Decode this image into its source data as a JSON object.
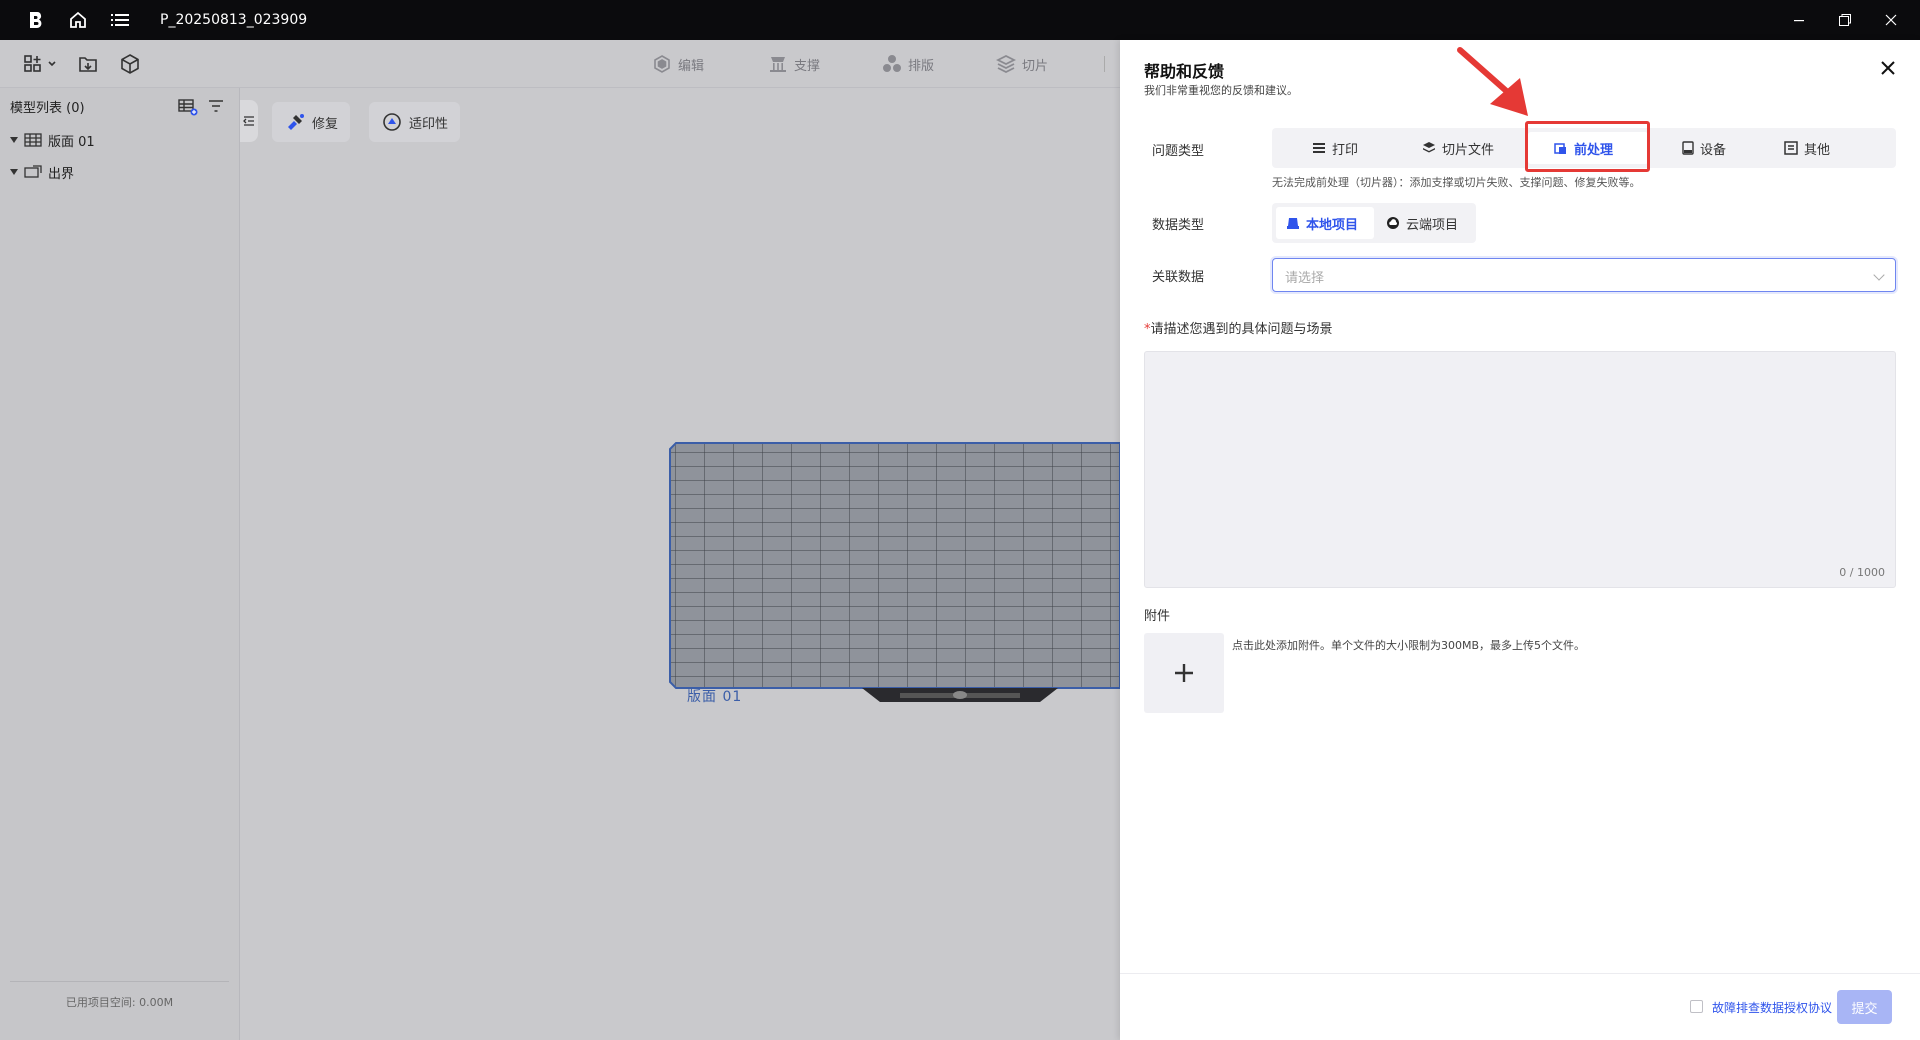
{
  "titlebar": {
    "project_name": "P_20250813_023909"
  },
  "toolbar": {
    "edit": "编辑",
    "support": "支撑",
    "layout": "排版",
    "slice": "切片"
  },
  "sidebar": {
    "header": "模型列表 (0)",
    "items": [
      {
        "label": "版面 01"
      },
      {
        "label": "出界"
      }
    ],
    "footer": "已用项目空间: 0.00M"
  },
  "viewport": {
    "repair_label": "修复",
    "printability_label": "适印性",
    "plate_label": "版面 01"
  },
  "panel": {
    "title": "帮助和反馈",
    "subtitle": "我们非常重视您的反馈和建议。",
    "issue_type_label": "问题类型",
    "issue_types": [
      {
        "label": "打印",
        "icon": "print-icon"
      },
      {
        "label": "切片文件",
        "icon": "layers-icon"
      },
      {
        "label": "前处理",
        "icon": "preprocess-icon"
      },
      {
        "label": "设备",
        "icon": "device-icon"
      },
      {
        "label": "其他",
        "icon": "other-icon"
      }
    ],
    "selected_issue_type": "前处理",
    "issue_hint": "无法完成前处理（切片器）：添加支撑或切片失败、支撑问题、修复失败等。",
    "data_type_label": "数据类型",
    "data_types": [
      {
        "label": "本地项目"
      },
      {
        "label": "云端项目"
      }
    ],
    "selected_data_type": "本地项目",
    "related_data_label": "关联数据",
    "related_data_placeholder": "请选择",
    "description_label": "请描述您遇到的具体问题与场景",
    "description_counter": "0 / 1000",
    "attachment_label": "附件",
    "attachment_hint": "点击此处添加附件。单个文件的大小限制为300MB，最多上传5个文件。",
    "agreement_label": "故障排查数据授权协议",
    "submit_label": "提交"
  },
  "colors": {
    "accent": "#2f54eb",
    "annotation": "#e53935",
    "titlebar": "#0b0b0d"
  }
}
